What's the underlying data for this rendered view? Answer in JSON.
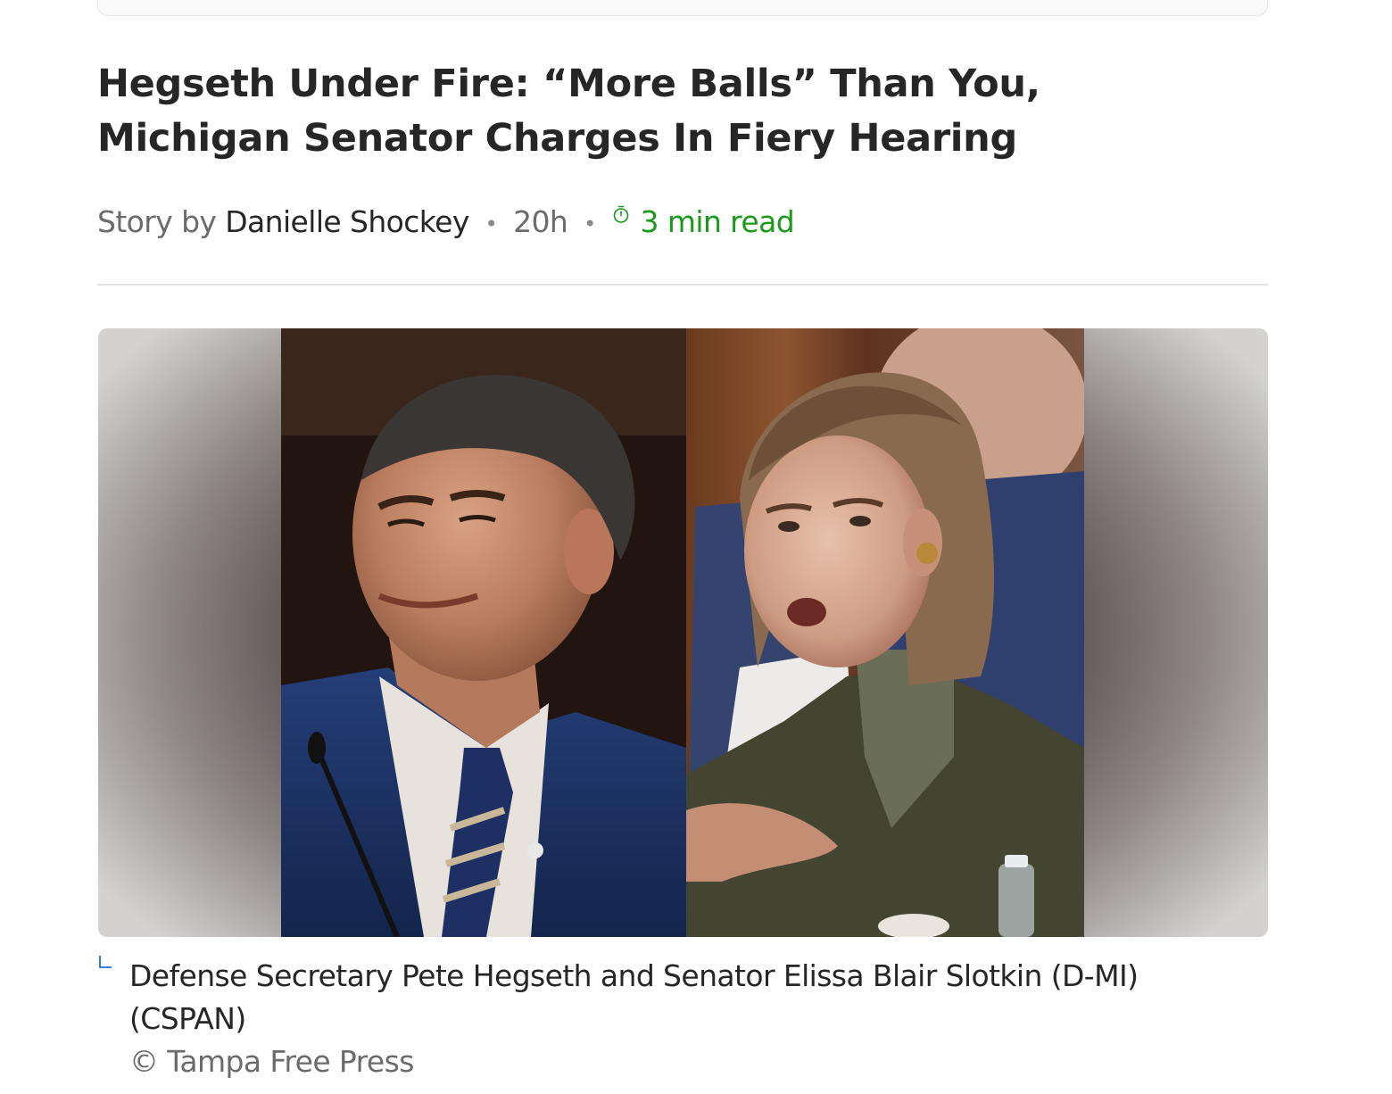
{
  "article": {
    "headline": "Hegseth Under Fire: “More Balls” Than You, Michigan Senator Charges In Fiery Hearing",
    "byline": {
      "prefix": "Story by",
      "author": "Danielle Shockey",
      "separator": "•",
      "age": "20h",
      "read_time": "3 min read"
    },
    "image": {
      "caption": "Defense Secretary Pete Hegseth and Senator Elissa Blair Slotkin (D-MI) (CSPAN)",
      "credit": "© Tampa Free Press"
    }
  },
  "icons": {
    "timer": "stopwatch-icon",
    "caption": "caption-corner-icon"
  },
  "colors": {
    "read_time": "#1a9a1a",
    "caption_icon": "#1b6fd6",
    "headline": "#262626",
    "muted": "#6b6b6b"
  }
}
